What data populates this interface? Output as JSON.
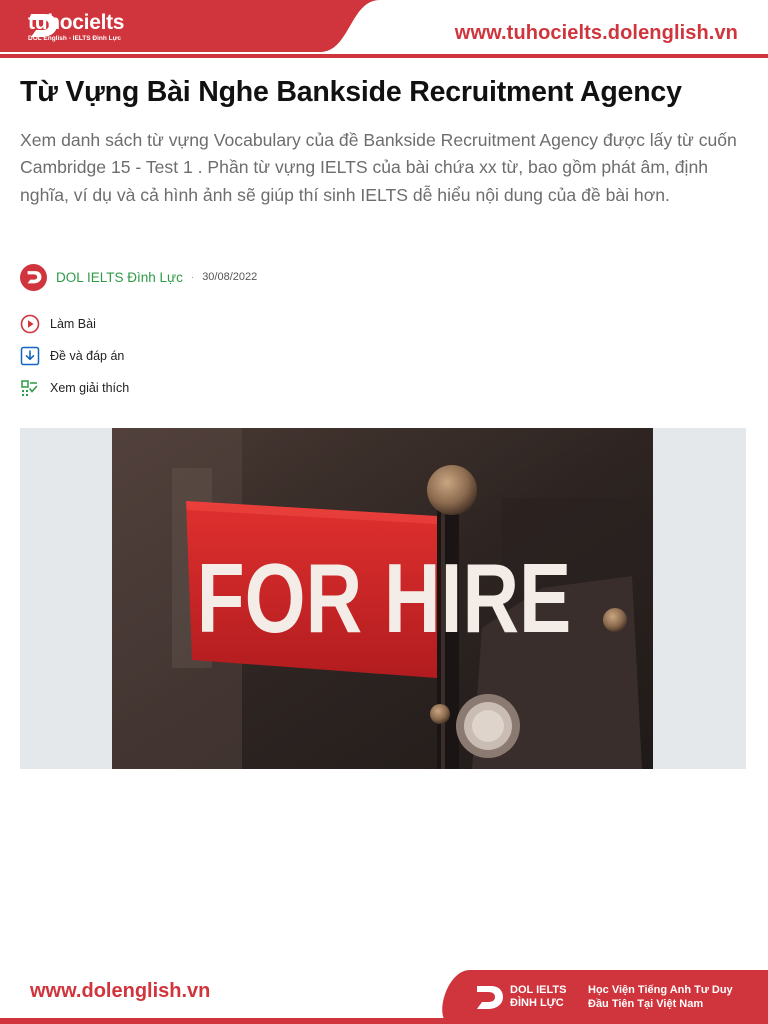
{
  "header": {
    "brand_name": "tuhocielts",
    "brand_subtitle": "DOL English - IELTS Đình Lực",
    "site_url": "www.tuhocielts.dolenglish.vn"
  },
  "article": {
    "title": "Từ Vựng Bài Nghe Bankside Recruitment Agency",
    "intro": "Xem danh sách từ vựng Vocabulary của đề Bankside Recruitment Agency được lấy từ cuốn Cambridge 15  - Test 1 . Phần từ vựng IELTS của bài chứa xx từ, bao gồm phát âm, định nghĩa, ví dụ và cả hình ảnh sẽ giúp thí sinh IELTS dễ hiểu nội dung của đề bài hơn.",
    "author": "DOL IELTS Đình Lực",
    "separator": "·",
    "date": "30/08/2022"
  },
  "actions": [
    {
      "label": "Làm Bài",
      "icon": "play-circle-icon"
    },
    {
      "label": "Đề và đáp án",
      "icon": "download-icon"
    },
    {
      "label": "Xem giải thích",
      "icon": "checklist-icon"
    }
  ],
  "figure": {
    "sign_text": "FOR HIRE"
  },
  "footer": {
    "site_url": "www.dolenglish.vn",
    "brand_line1": "DOL IELTS",
    "brand_line2": "ĐÌNH LỰC",
    "slogan_line1": "Học Viện Tiếng Anh Tư Duy",
    "slogan_line2": "Đầu Tiên Tại Việt Nam"
  },
  "colors": {
    "brand_red": "#d0343c",
    "author_green": "#2e9b47",
    "action_blue": "#1565c0",
    "action_green": "#2e9b47",
    "figure_bg": "#e5e8eb"
  }
}
